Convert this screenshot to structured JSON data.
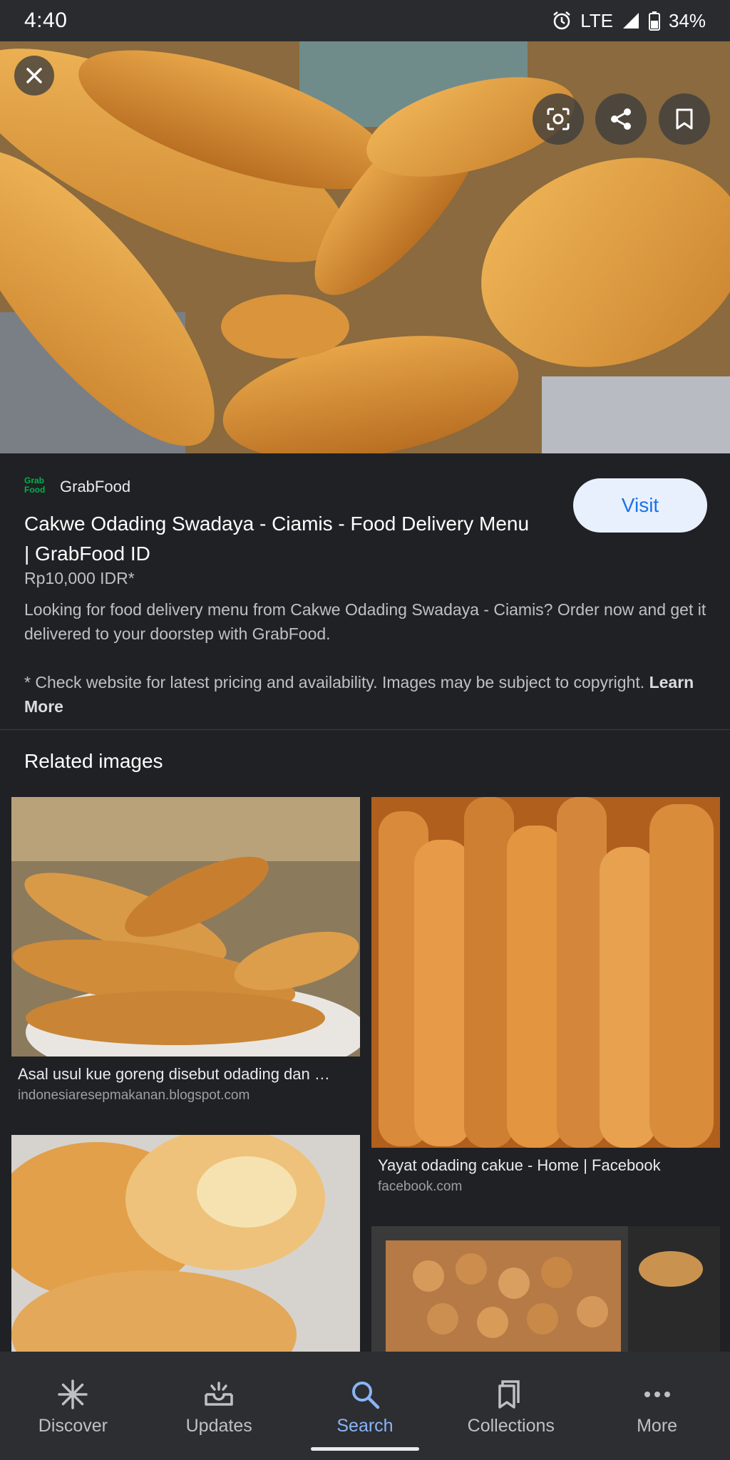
{
  "status_bar": {
    "time": "4:40",
    "network": "LTE",
    "battery": "34%"
  },
  "hero": {
    "icons": [
      "close-icon",
      "lens-icon",
      "share-icon",
      "bookmark-icon"
    ]
  },
  "result": {
    "source_logo_text": "Grab Food",
    "source_name": "GrabFood",
    "visit_label": "Visit",
    "title": "Cakwe Odading Swadaya - Ciamis - Food Delivery Menu | GrabFood ID",
    "price": "Rp10,000 IDR*",
    "description": "Looking for food delivery menu from Cakwe Odading Swadaya - Ciamis? Order now and get it delivered to your doorstep with GrabFood.",
    "disclaimer": "* Check website for latest pricing and availability. Images may be subject to copyright.",
    "learn_more": "Learn More"
  },
  "related": {
    "title": "Related images",
    "items": [
      {
        "caption": "Asal usul kue goreng disebut odading dan …",
        "source": "indonesiaresepmakanan.blogspot.com"
      },
      {
        "caption": "Yayat odading cakue - Home | Facebook",
        "source": "facebook.com"
      }
    ]
  },
  "bottom_nav": {
    "items": [
      {
        "label": "Discover",
        "icon": "asterisk-icon"
      },
      {
        "label": "Updates",
        "icon": "inbox-icon"
      },
      {
        "label": "Search",
        "icon": "search-icon",
        "active": true
      },
      {
        "label": "Collections",
        "icon": "collections-icon"
      },
      {
        "label": "More",
        "icon": "more-icon"
      }
    ]
  },
  "colors": {
    "background": "#202124",
    "accent": "#8ab4f8",
    "visit_bg": "#e8f0fe",
    "visit_text": "#1a73e8",
    "grab_green": "#00b14f"
  }
}
